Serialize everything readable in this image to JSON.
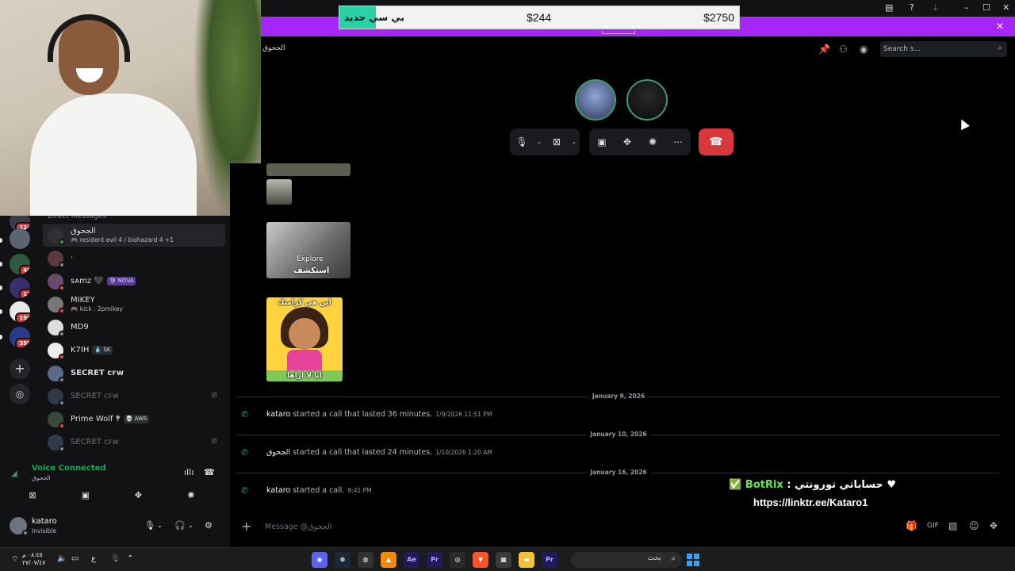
{
  "promo": {
    "ticker_label": "بي سي جديد",
    "price_1": "$244",
    "price_2": "$2750",
    "close_glyph": "✕"
  },
  "window_controls": {
    "minimize": "–",
    "maximize": "☐",
    "close": "✕"
  },
  "channel": {
    "name": "الجحوق",
    "search_placeholder": "Search s..."
  },
  "servers": [
    {
      "badge": "124"
    },
    {
      "badge": ""
    },
    {
      "badge": "49"
    },
    {
      "badge": "17"
    },
    {
      "badge": "195"
    },
    {
      "badge": "358"
    }
  ],
  "dm": {
    "header": "Direct Messages",
    "items": [
      {
        "name": "الجحوق",
        "sub": "🎮 resident evil 4 / biohazard 4 +1"
      },
      {
        "name": "·",
        "sub": ""
      },
      {
        "name": "sᴀmz 🖤",
        "tag": "🔮 NOVA",
        "sub": ""
      },
      {
        "name": "MIKEY",
        "sub": "🎮 kick : 2pmikey"
      },
      {
        "name": "MD9",
        "sub": ""
      },
      {
        "name": "K7IH",
        "tag": "💧 SK",
        "sub": ""
      },
      {
        "name": "SECRET ᴄꜰᴡ",
        "sub": ""
      },
      {
        "name": "SECRET ᴄꜰᴡ",
        "sub": ""
      },
      {
        "name": "Prime Wolf 🕈",
        "tag": "💀 AWS",
        "sub": ""
      },
      {
        "name": "SECRET ᴄꜰᴡ",
        "sub": ""
      }
    ]
  },
  "voice": {
    "title": "Voice Connected",
    "channel": "الجحوق"
  },
  "user": {
    "name": "kataro",
    "status": "Invisible"
  },
  "messages": {
    "explore_text": "Explore",
    "explore_ar": "استكشف",
    "dora_top": "اين هي كرامتك",
    "dora_bottom": "انا لا اراها",
    "dates": [
      "January 9, 2026",
      "January 10, 2026",
      "January 16, 2026"
    ],
    "calls": [
      {
        "who": "kataro",
        "text": "started a call that lasted 36 minutes.",
        "ts": "1/9/2026 11:51 PM"
      },
      {
        "who": "الجحوق",
        "text": "started a call that lasted 24 minutes.",
        "ts": "1/10/2026 1:20 AM"
      },
      {
        "who": "kataro",
        "text": "started a call.",
        "ts": "8:41 PM"
      }
    ]
  },
  "overlay": {
    "line1_prefix": "حساباتي تورونتي : ",
    "line1_bot": "BotRix",
    "line2": "https://linktr.ee/Kataro1"
  },
  "composer": {
    "placeholder": "Message @الجحوق"
  },
  "taskbar": {
    "time": "٠٨:٤٥ م",
    "date": "٢٧/٠٧/٤٧",
    "lang": "ع",
    "search_text": "بحث"
  }
}
